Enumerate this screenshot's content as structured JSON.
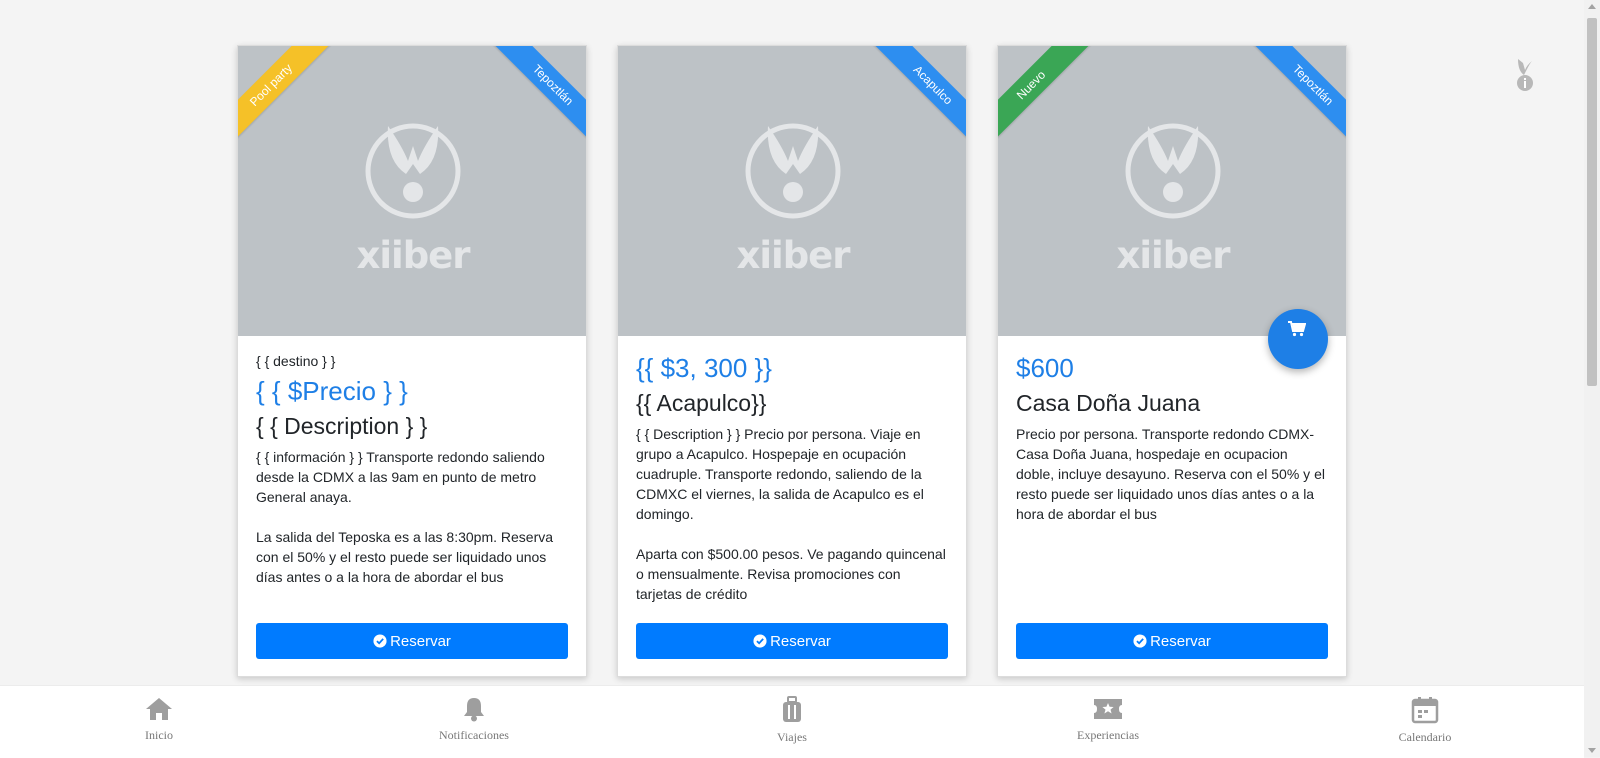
{
  "cards": [
    {
      "ribbon_left": "Pool party",
      "ribbon_left_color": "#f5c128",
      "ribbon_right": "Tepoztlán",
      "ribbon_right_color": "#2d8ef0",
      "logo_text": "xiiber",
      "subtitle": "{ { destino } }",
      "price": "{ { $Precio } }",
      "title": "{ { Description } }",
      "description": "{ { información } } Transporte redondo saliendo desde la CDMX a las 9am en punto de metro General anaya.\n\nLa salida del Teposka es a las 8:30pm. Reserva con el 50% y el resto puede ser liquidado unos días antes o a la hora de abordar el bus",
      "button_label": "Reservar"
    },
    {
      "ribbon_right": "Acapulco",
      "ribbon_right_color": "#2d8ef0",
      "logo_text": "xiiber",
      "price": "{{ $3, 300 }}",
      "title": "{{ Acapulco}}",
      "description": "{ { Description } } Precio por persona. Viaje en grupo a Acapulco. Hospepaje en ocupación cuadruple. Transporte redondo, saliendo de la CDMXC el viernes, la salida de Acapulco es el domingo.\n\nAparta con $500.00 pesos. Ve pagando quincenal o mensualmente. Revisa promociones con tarjetas de crédito",
      "button_label": "Reservar"
    },
    {
      "ribbon_left": "Nuevo",
      "ribbon_left_color": "#3aa655",
      "ribbon_right": "Tepoztlán",
      "ribbon_right_color": "#2d8ef0",
      "logo_text": "xiiber",
      "price": "$600",
      "title": "Casa Doña Juana",
      "description": "Precio por persona. Transporte redondo CDMX-Casa Doña Juana, hospedaje en ocupacion doble, incluye desayuno. Reserva con el 50% y el resto puede ser liquidado unos días antes o a la hora de abordar el bus",
      "button_label": "Reservar"
    }
  ],
  "bottom_nav": [
    {
      "label": "Inicio",
      "icon": "home-icon"
    },
    {
      "label": "Notificaciones",
      "icon": "bell-icon"
    },
    {
      "label": "Viajes",
      "icon": "luggage-icon"
    },
    {
      "label": "Experiencias",
      "icon": "ticket-icon"
    },
    {
      "label": "Calendario",
      "icon": "calendar-icon"
    }
  ],
  "colors": {
    "primary": "#007bff",
    "price": "#1e7fe6",
    "image_bg": "#bdc2c6",
    "nav_icon": "#9e9e9e"
  }
}
